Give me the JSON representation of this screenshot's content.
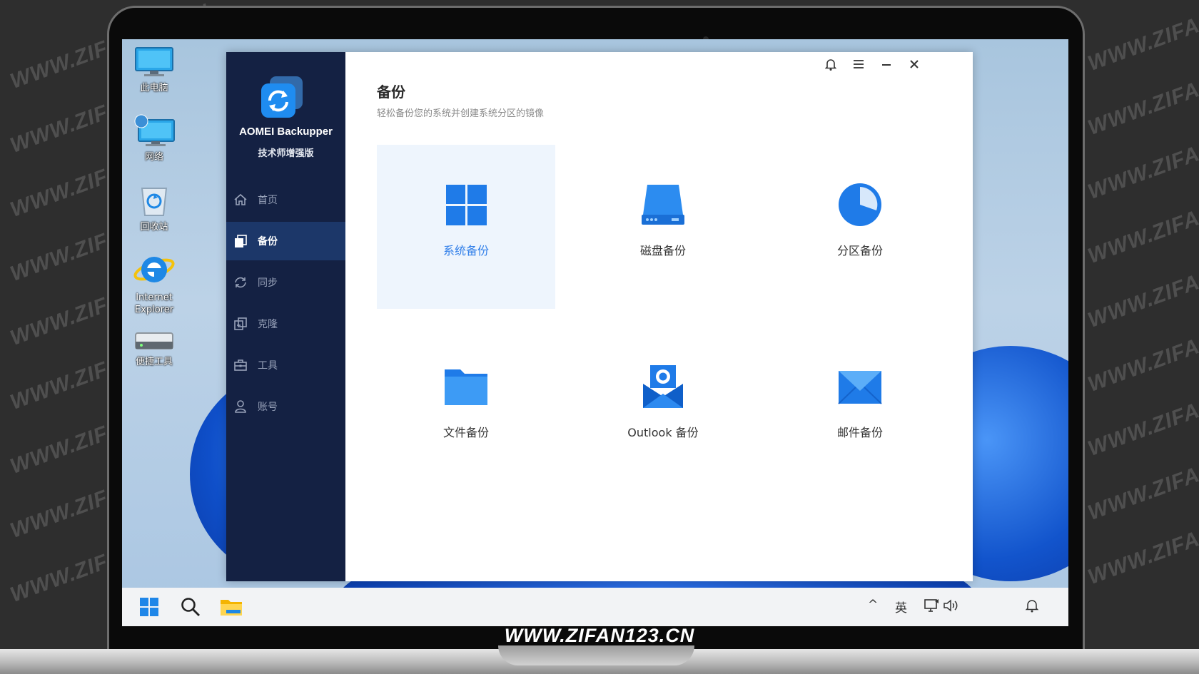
{
  "watermark": "WWW.ZIFAN123.CN",
  "desktop_icons": [
    {
      "label": "此电脑",
      "icon": "computer-icon"
    },
    {
      "label": "网络",
      "icon": "network-icon"
    },
    {
      "label": "回收站",
      "icon": "recycle-bin-icon"
    },
    {
      "label": "Internet Explorer",
      "icon": "ie-icon"
    },
    {
      "label": "便捷工具",
      "icon": "drive-icon"
    }
  ],
  "app": {
    "name": "AOMEI Backupper",
    "edition": "技术师增强版",
    "nav": [
      {
        "label": "首页",
        "icon": "home-icon"
      },
      {
        "label": "备份",
        "icon": "backup-icon",
        "active": true
      },
      {
        "label": "同步",
        "icon": "sync-icon"
      },
      {
        "label": "克隆",
        "icon": "clone-icon"
      },
      {
        "label": "工具",
        "icon": "toolbox-icon"
      },
      {
        "label": "账号",
        "icon": "user-icon"
      }
    ],
    "window_controls": [
      "bell-icon",
      "menu-icon",
      "minimize-icon",
      "close-icon"
    ]
  },
  "main": {
    "title": "备份",
    "subtitle": "轻松备份您的系统并创建系统分区的镜像",
    "options": [
      {
        "label": "系统备份",
        "icon": "windows-icon",
        "selected": true
      },
      {
        "label": "磁盘备份",
        "icon": "disk-icon"
      },
      {
        "label": "分区备份",
        "icon": "partition-pie-icon"
      },
      {
        "label": "文件备份",
        "icon": "folder-icon"
      },
      {
        "label": "Outlook 备份",
        "icon": "outlook-icon"
      },
      {
        "label": "邮件备份",
        "icon": "mail-icon"
      }
    ]
  },
  "taskbar": {
    "tray_chevron": "^",
    "ime": "英",
    "pinned": [
      "start-icon",
      "search-icon",
      "file-explorer-icon"
    ],
    "tray_icons": [
      "network-icon",
      "volume-icon",
      "notification-icon"
    ]
  },
  "colors": {
    "accent": "#2f7ee9",
    "sidebar": "#142143",
    "sidebar_active": "#1c3769"
  }
}
